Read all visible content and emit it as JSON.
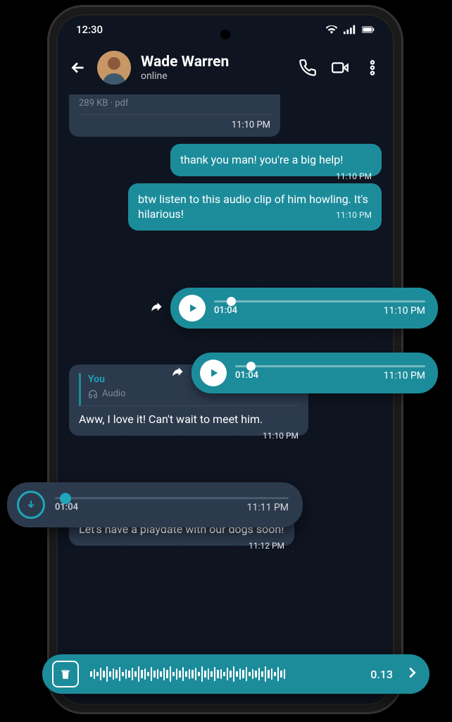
{
  "status": {
    "time": "12:30"
  },
  "header": {
    "name": "Wade Warren",
    "status": "online"
  },
  "messages": {
    "file_partial": {
      "meta": "289 KB · pdf",
      "time": "11:10 PM"
    },
    "m1": {
      "text": "thank you man! you're a big help!",
      "time": "11:10 PM"
    },
    "m2": {
      "text": "btw listen to this audio clip of him howling. It's hilarious!",
      "time": "11:10 PM"
    },
    "audio1": {
      "duration": "01:04",
      "time": "11:10 PM"
    },
    "audio2": {
      "duration": "01:04",
      "time": "11:10 PM"
    },
    "reply": {
      "sender": "You",
      "type": "Audio",
      "text": "Aww, I love it! Can't wait to meet him.",
      "time": "11:10 PM"
    },
    "inc_audio": {
      "duration": "01:04",
      "time": "11:11 PM"
    },
    "m3": {
      "text": "Let's have a playdate with our dogs soon!",
      "time": "11:12 PM"
    }
  },
  "recording": {
    "time": "0.13"
  }
}
